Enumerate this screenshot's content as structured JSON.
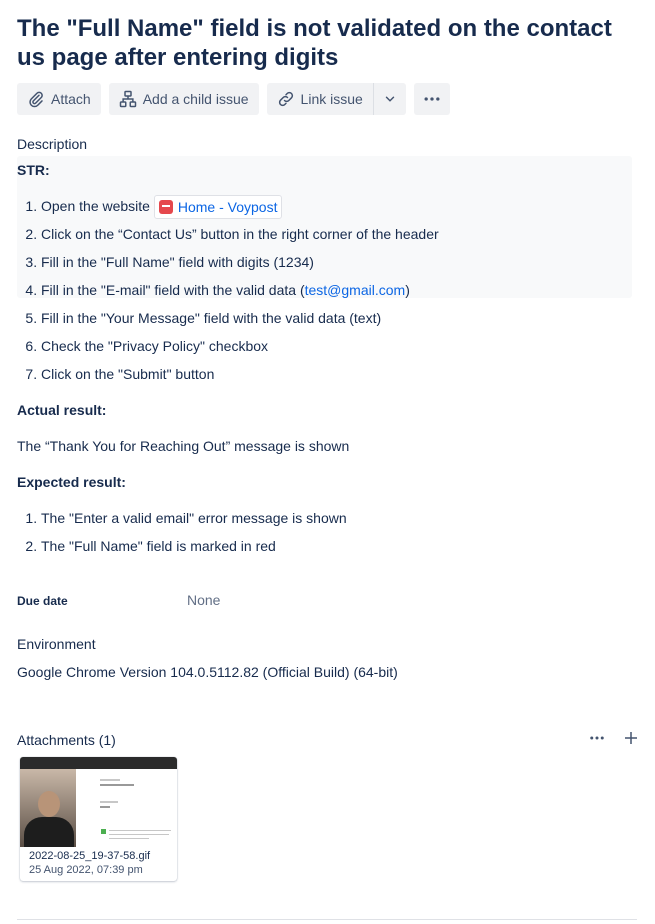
{
  "issue": {
    "title": "The \"Full Name\" field is not validated on the contact us page after entering digits"
  },
  "toolbar": {
    "attach_label": "Attach",
    "child_issue_label": "Add a child issue",
    "link_issue_label": "Link issue",
    "more_icon": "more-horizontal-icon"
  },
  "description": {
    "heading": "Description",
    "str_heading": "STR:",
    "steps": [
      {
        "prefix": "Open the website ",
        "link_text": "Home - Voypost"
      },
      {
        "text": "Click on the “Contact Us” button in the right corner of the header"
      },
      {
        "text": "Fill in the \"Full Name\" field with digits (1234)"
      },
      {
        "prefix": "Fill in the \"E-mail\" field with the valid data (",
        "link_text": "test@gmail.com",
        "suffix": ")"
      },
      {
        "text": "Fill in the \"Your Message\" field with the valid data (text)"
      },
      {
        "text": "Check the \"Privacy Policy\" checkbox"
      },
      {
        "text": "Click on the \"Submit\" button"
      }
    ],
    "actual_heading": "Actual result:",
    "actual_text": "The “Thank You for Reaching Out” message is shown",
    "expected_heading": "Expected result:",
    "expected_items": [
      "The \"Enter a valid email\" error message is shown",
      "The \"Full Name\" field is marked in red"
    ]
  },
  "fields": {
    "due_date_label": "Due date",
    "due_date_value": "None",
    "environment_label": "Environment",
    "environment_value": "Google Chrome Version 104.0.5112.82 (Official Build) (64-bit)"
  },
  "attachments": {
    "heading": "Attachments (1)",
    "items": [
      {
        "file_name": "2022-08-25_19-37-58.gif",
        "date": "25 Aug 2022, 07:39 pm"
      }
    ]
  }
}
